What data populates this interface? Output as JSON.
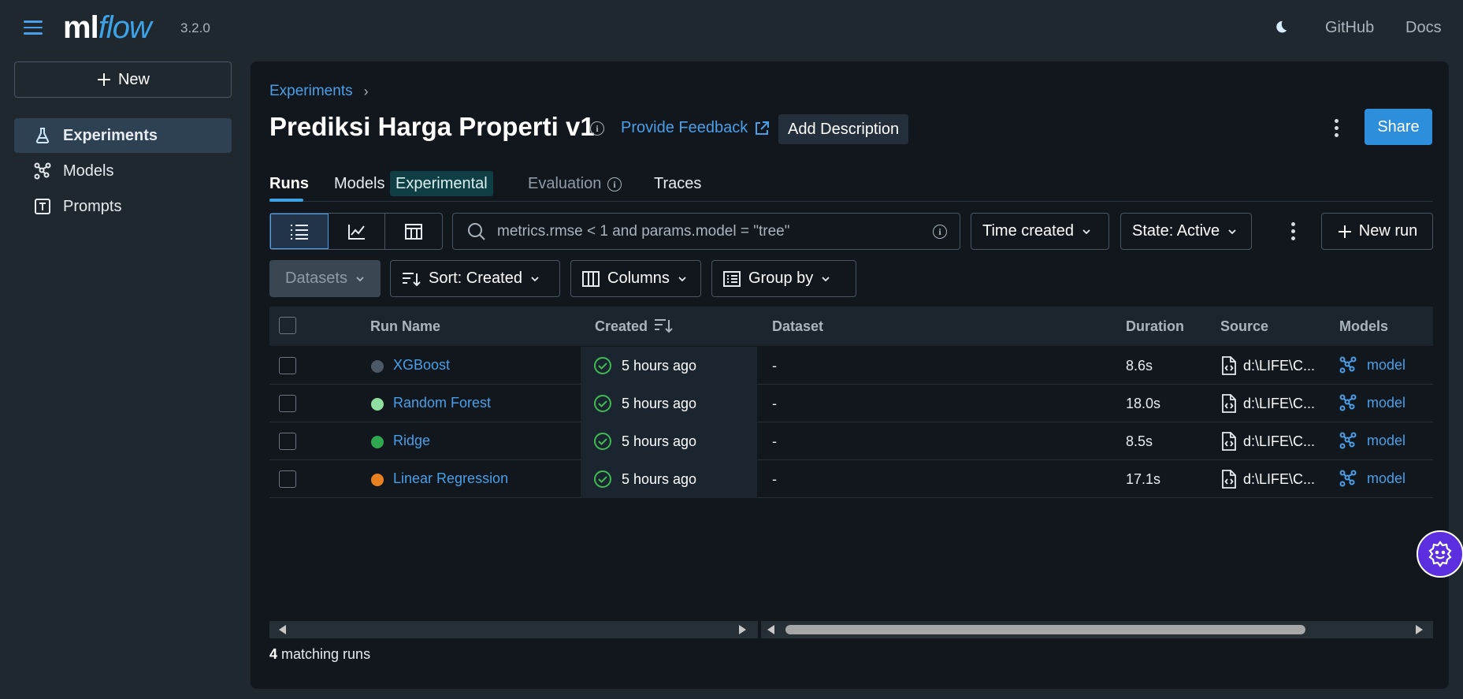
{
  "header": {
    "logo_ml": "ml",
    "logo_flow": "flow",
    "version": "3.2.0",
    "links": [
      "GitHub",
      "Docs"
    ]
  },
  "sidebar": {
    "new_label": "New",
    "items": [
      {
        "label": "Experiments",
        "icon": "flask-icon",
        "active": true
      },
      {
        "label": "Models",
        "icon": "models-icon",
        "active": false
      },
      {
        "label": "Prompts",
        "icon": "prompt-icon",
        "active": false
      }
    ]
  },
  "page": {
    "breadcrumb": "Experiments",
    "title": "Prediksi Harga Properti v1",
    "feedback": "Provide Feedback",
    "add_description": "Add Description",
    "share": "Share"
  },
  "tabs": {
    "runs": "Runs",
    "models": "Models",
    "experimental": "Experimental",
    "evaluation": "Evaluation",
    "traces": "Traces"
  },
  "toolbar": {
    "search_placeholder": "metrics.rmse < 1 and params.model = \"tree\"",
    "time_created": "Time created",
    "state": "State: Active",
    "new_run": "New run",
    "datasets": "Datasets",
    "sort": "Sort: Created",
    "columns": "Columns",
    "group_by": "Group by"
  },
  "table": {
    "columns": [
      "Run Name",
      "Created",
      "Dataset",
      "Duration",
      "Source",
      "Models"
    ],
    "rows": [
      {
        "name": "XGBoost",
        "color": "#4b5865",
        "created": "5 hours ago",
        "dataset": "-",
        "duration": "8.6s",
        "source": "d:\\LIFE\\C...",
        "model": "model"
      },
      {
        "name": "Random Forest",
        "color": "#8fe0a0",
        "created": "5 hours ago",
        "dataset": "-",
        "duration": "18.0s",
        "source": "d:\\LIFE\\C...",
        "model": "model"
      },
      {
        "name": "Ridge",
        "color": "#2fa84f",
        "created": "5 hours ago",
        "dataset": "-",
        "duration": "8.5s",
        "source": "d:\\LIFE\\C...",
        "model": "model"
      },
      {
        "name": "Linear Regression",
        "color": "#e8801f",
        "created": "5 hours ago",
        "dataset": "-",
        "duration": "17.1s",
        "source": "d:\\LIFE\\C...",
        "model": "model"
      }
    ]
  },
  "footer": {
    "count": "4",
    "count_suffix": " matching runs"
  },
  "colors": {
    "accent": "#2d8fdb",
    "link": "#4a9fe8",
    "success": "#3fb950"
  }
}
